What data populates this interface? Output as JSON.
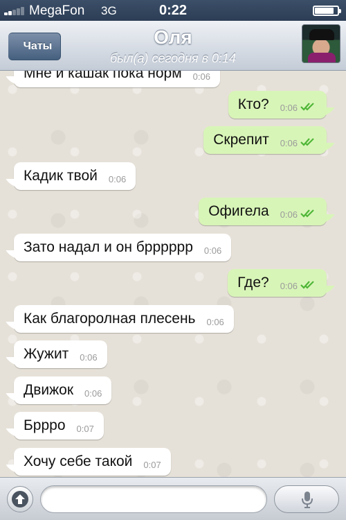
{
  "status_bar": {
    "carrier": "MegaFon",
    "network": "3G",
    "time": "0:22",
    "battery_level_percent": 80,
    "signal_bars": 2
  },
  "nav": {
    "back_label": "Чаты",
    "title": "Оля",
    "subtitle": "был(а) сегодня в 0:14",
    "avatar_icon": "avatar-photo"
  },
  "messages": [
    {
      "direction": "in",
      "text": "Мне и кашак пока норм",
      "time": "0:06",
      "read": false
    },
    {
      "direction": "out",
      "text": "Кто?",
      "time": "0:06",
      "read": true
    },
    {
      "direction": "out",
      "text": "Скрепит",
      "time": "0:06",
      "read": true
    },
    {
      "direction": "in",
      "text": "Кадик твой",
      "time": "0:06",
      "read": false
    },
    {
      "direction": "out",
      "text": "Офигела",
      "time": "0:06",
      "read": true
    },
    {
      "direction": "in",
      "text": "Зато надал и он брррррр",
      "time": "0:06",
      "read": false
    },
    {
      "direction": "out",
      "text": "Где?",
      "time": "0:06",
      "read": true
    },
    {
      "direction": "in",
      "text": "Как благоролная плесень",
      "time": "0:06",
      "read": false
    },
    {
      "direction": "in",
      "text": "Жужит",
      "time": "0:06",
      "read": false
    },
    {
      "direction": "in",
      "text": "Движок",
      "time": "0:06",
      "read": false
    },
    {
      "direction": "in",
      "text": "Бррро",
      "time": "0:07",
      "read": false
    },
    {
      "direction": "in",
      "text": "Хочу себе такой",
      "time": "0:07",
      "read": false
    }
  ],
  "input": {
    "value": "",
    "placeholder": "",
    "upload_icon": "upload-arrow-icon",
    "mic_icon": "microphone-icon"
  },
  "colors": {
    "outgoing_bubble": "#d8f5b8",
    "incoming_bubble": "#ffffff",
    "read_check": "#4fb637",
    "chat_background": "#e6e1d8"
  }
}
